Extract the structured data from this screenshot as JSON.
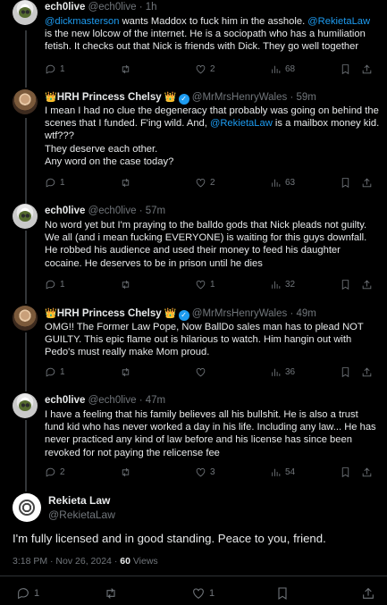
{
  "tweets": [
    {
      "name": "ech0live",
      "handle": "@ech0live",
      "time": "1h",
      "body_link": "@dickmasterson",
      "body_a": " wants Maddox to fuck him in the asshole. ",
      "body_link2": "@RekietaLaw",
      "body_b": " is the new lolcow of the internet. He is a sociopath who has a humiliation fetish. It checks out that Nick is friends with Dick. They go well together",
      "replies": "1",
      "retweets": "",
      "likes": "2",
      "views": "68"
    },
    {
      "name": "HRH Princess Chelsy",
      "handle": "@MrMrsHenryWales",
      "time": "59m",
      "line1": "I mean I had no clue the degeneracy that probably was going on behind the scenes that I funded. F'ing wild. And, ",
      "link": "@RekietaLaw",
      "line1b": " is a mailbox money kid. wtf???",
      "line2": "They deserve each other.",
      "line3": "Any word on the case today?",
      "replies": "1",
      "retweets": "",
      "likes": "2",
      "views": "63"
    },
    {
      "name": "ech0live",
      "handle": "@ech0live",
      "time": "57m",
      "body": "No word yet but I'm praying to the balldo gods that Nick pleads not guilty. We all (and i mean fucking EVERYONE) is waiting for this guys downfall. He robbed his audience and used their money to feed his daughter cocaine. He deserves to be in prison until he dies",
      "replies": "1",
      "retweets": "",
      "likes": "1",
      "views": "32"
    },
    {
      "name": "HRH Princess Chelsy",
      "handle": "@MrMrsHenryWales",
      "time": "49m",
      "body": "OMG!!  The Former Law Pope, Now BallDo sales man has to plead NOT GUILTY.  This epic flame out is hilarious to watch. Him hangin out with Pedo's must really make Mom proud.",
      "replies": "1",
      "retweets": "",
      "likes": "",
      "views": "36"
    },
    {
      "name": "ech0live",
      "handle": "@ech0live",
      "time": "47m",
      "body": "I have a feeling that his family believes all his bullshit. He is also a trust fund kid who has never worked a day in his life. Including any law... He has never practiced any kind of law before and his license has since been revoked for not paying the relicense fee",
      "replies": "2",
      "retweets": "",
      "likes": "3",
      "views": "54"
    }
  ],
  "main": {
    "name": "Rekieta Law",
    "handle": "@RekietaLaw",
    "body": "I'm fully licensed and in good standing.  Peace to you, friend.",
    "timestamp": "3:18 PM · Nov 26, 2024 · ",
    "views_count": "60",
    "views_label": " Views",
    "replies": "1",
    "retweets": "",
    "likes": "1"
  },
  "dots": "·",
  "crown_glyph": "👑",
  "verified_glyph": "✓",
  "more_glyph": "···"
}
